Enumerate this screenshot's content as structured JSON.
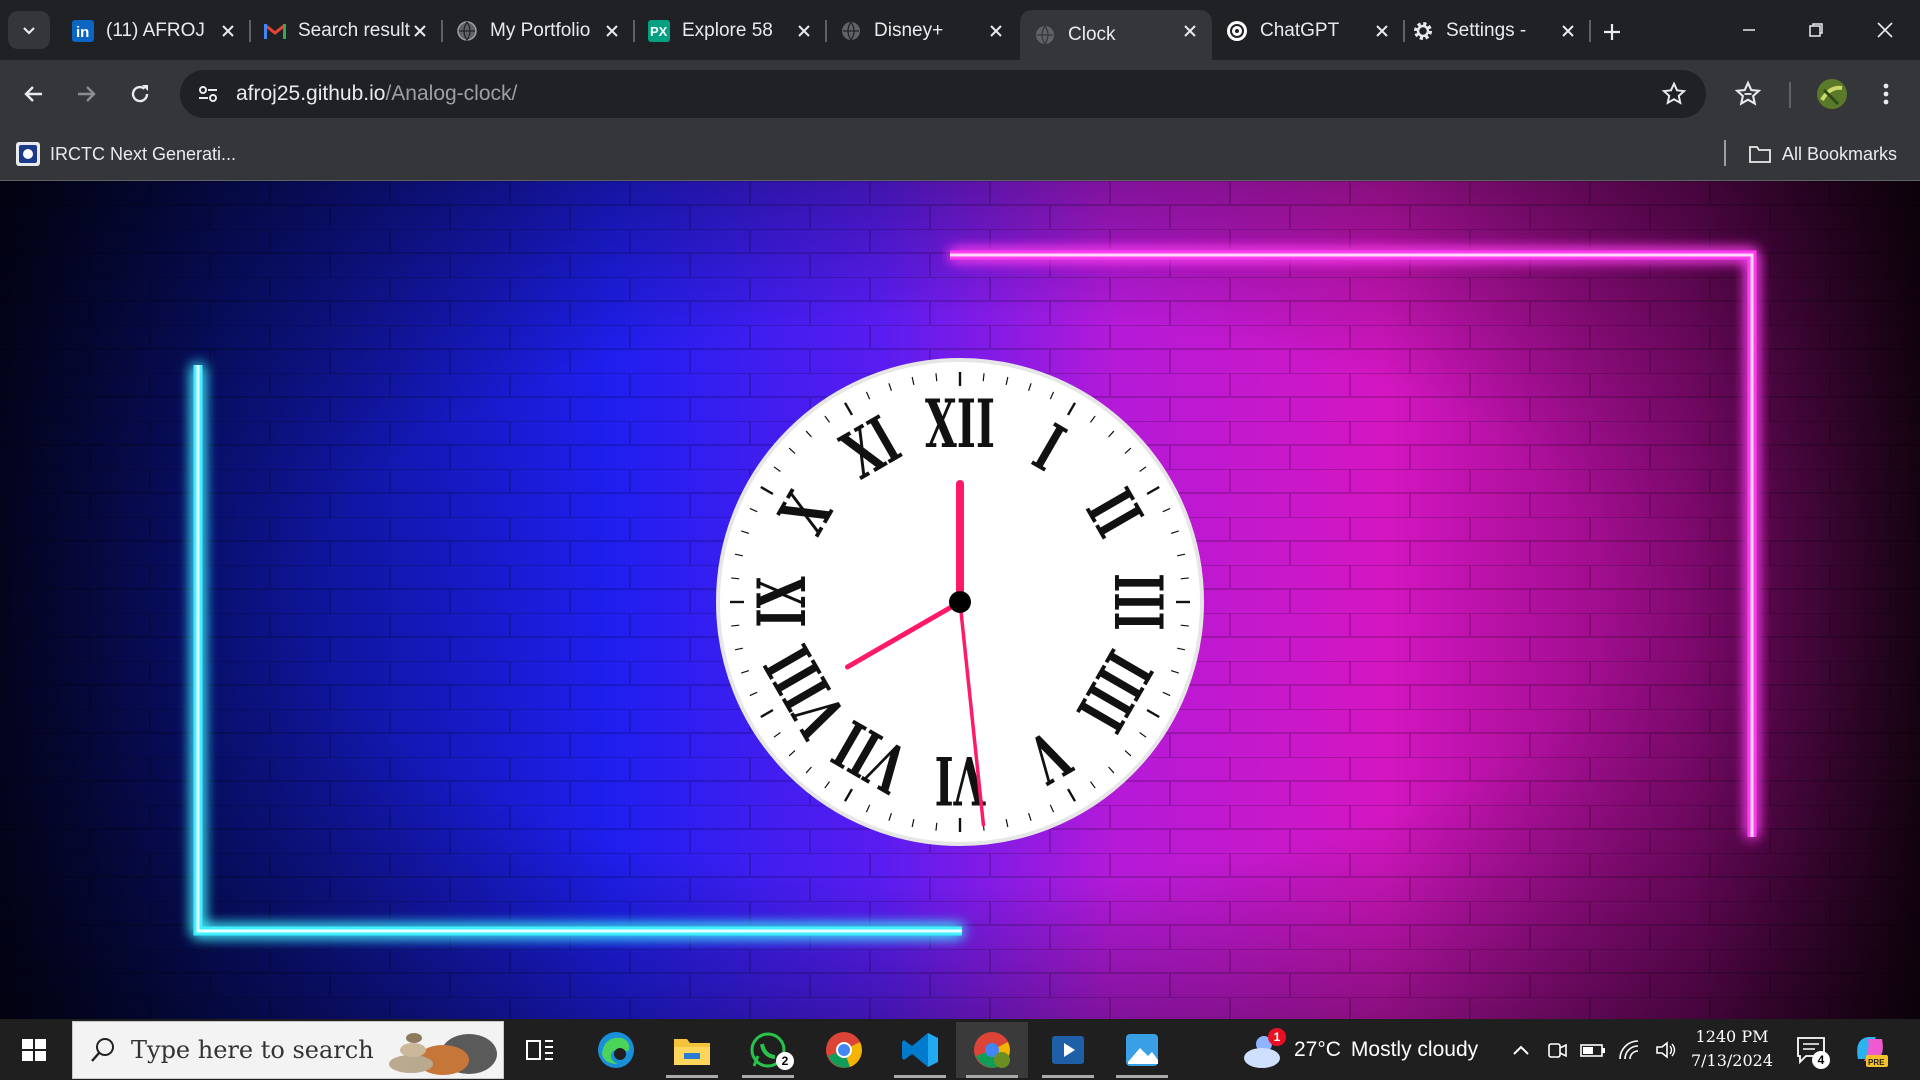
{
  "browser": {
    "tabs": [
      {
        "title": "(11) AFROJ",
        "icon": "linkedin-icon",
        "active": false
      },
      {
        "title": "Search results",
        "icon": "gmail-icon",
        "active": false
      },
      {
        "title": "My Portfolio",
        "icon": "globe-icon",
        "active": false
      },
      {
        "title": "Explore 58",
        "icon": "px-icon",
        "active": false
      },
      {
        "title": "Disney+",
        "icon": "globe-icon",
        "active": false
      },
      {
        "title": "Clock",
        "icon": "globe-icon",
        "active": true
      },
      {
        "title": "ChatGPT",
        "icon": "chatgpt-icon",
        "active": false
      },
      {
        "title": "Settings - ",
        "icon": "gear-icon",
        "active": false
      }
    ],
    "address": {
      "host": "afroj25.github.io",
      "path": "/Analog-clock/"
    },
    "bookmarks": {
      "first": "IRCTC Next Generati...",
      "all": "All Bookmarks"
    }
  },
  "clock": {
    "numerals": [
      "XII",
      "I",
      "II",
      "III",
      "IIII",
      "V",
      "VI",
      "VII",
      "VIII",
      "IX",
      "X",
      "XI"
    ],
    "hour_value": 8.0,
    "minute_value": 0.0,
    "second_value": 29.0,
    "hand_color": "#ff1a66"
  },
  "taskbar": {
    "search_placeholder": "Type here to search",
    "whatsapp_badge": "2",
    "weather_badge": "1",
    "temperature": "27°C",
    "condition": "Mostly cloudy",
    "time": "12​40 PM",
    "date": "7/13/2024",
    "notification_count": "4"
  }
}
